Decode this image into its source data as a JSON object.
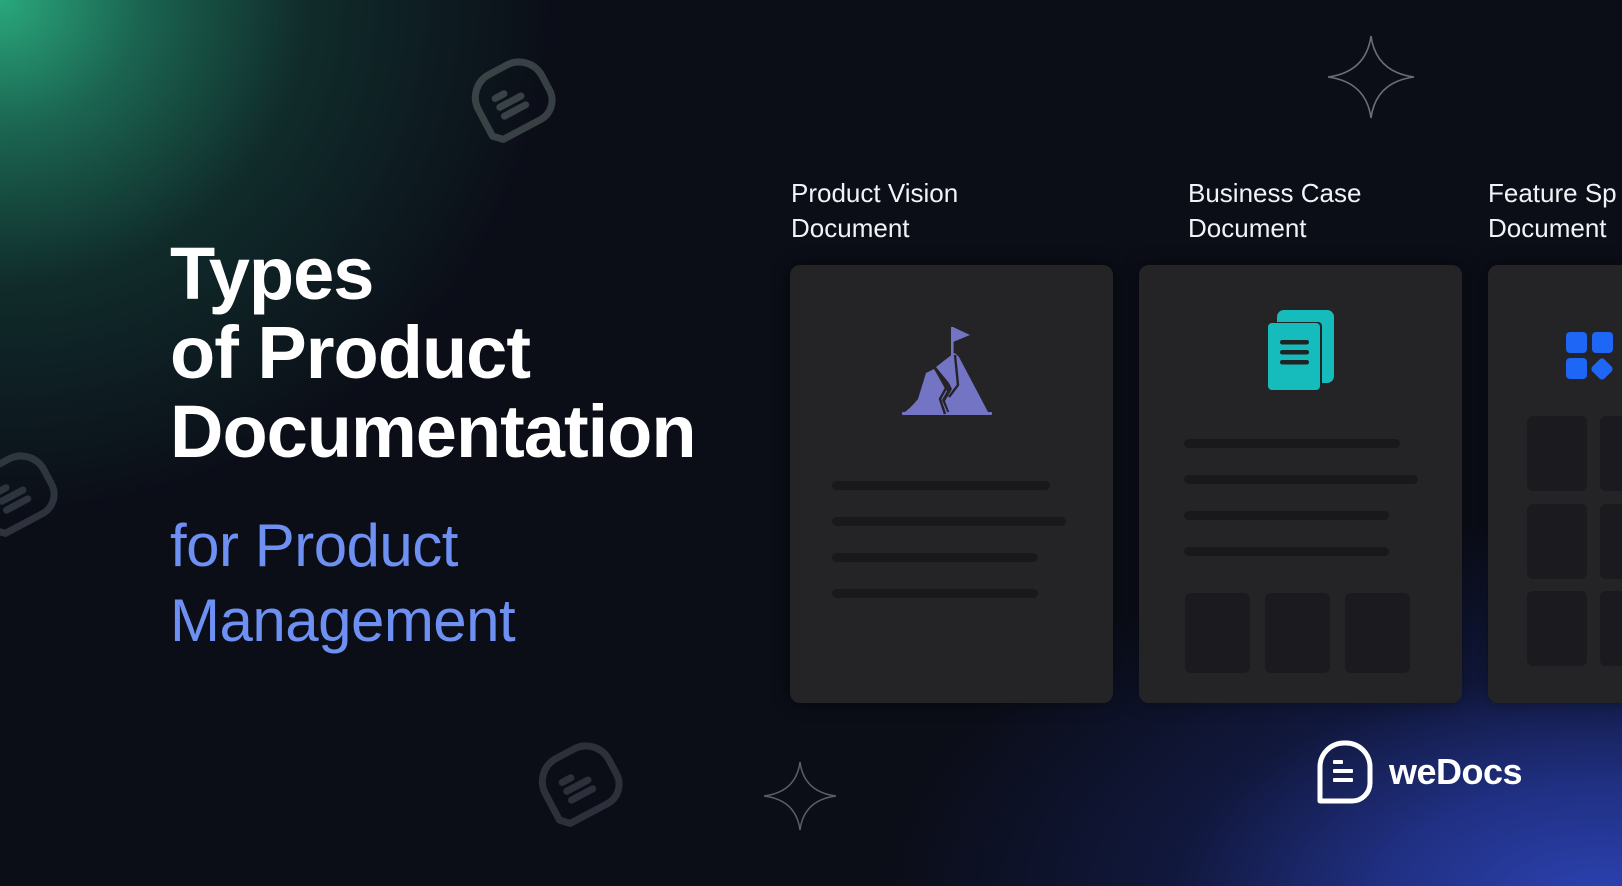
{
  "heading": {
    "lines": [
      "Types",
      "of Product",
      "Documentation"
    ],
    "color": "#ffffff"
  },
  "subheading": {
    "lines": [
      "for Product",
      "Management"
    ],
    "color": "#6e90f2"
  },
  "cards": [
    {
      "title_lines": [
        "Product Vision",
        "Document"
      ],
      "icon": "mountain-flag-icon",
      "icon_color": "#7474c4"
    },
    {
      "title_lines": [
        "Business Case",
        "Document"
      ],
      "icon": "documents-icon",
      "icon_color": "#16bcbc"
    },
    {
      "title_lines": [
        "Feature Sp",
        "Document"
      ],
      "icon": "blocks-icon",
      "icon_color": "#1e66f5"
    }
  ],
  "brand": {
    "name": "weDocs",
    "icon": "wedocs-logo-icon"
  },
  "decorations": {
    "stars": [
      "sparkle-icon",
      "sparkle-icon"
    ],
    "bubbles": [
      "wedocs-bubble-icon",
      "wedocs-bubble-icon",
      "wedocs-bubble-icon"
    ]
  },
  "colors": {
    "background": "#0b0d17",
    "green_glow": "#2aa87c",
    "blue_glow": "#2c42b2",
    "card": "#242427",
    "placeholder": "#19191c"
  }
}
